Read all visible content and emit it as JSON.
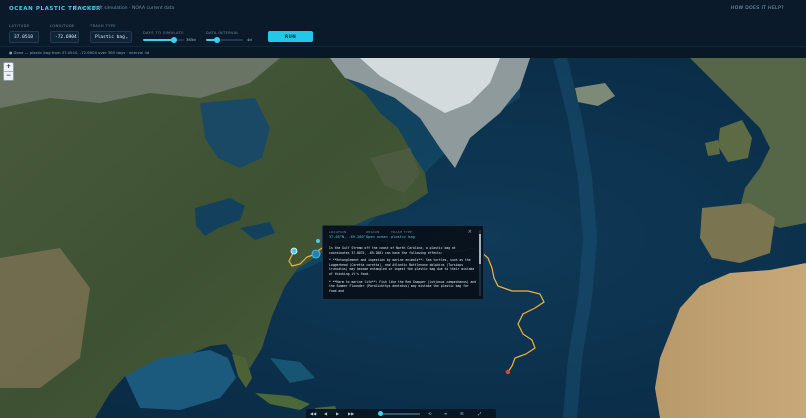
{
  "header": {
    "title": "OCEAN PLASTIC TRACKER",
    "subtitle": "Oceanic drift simulation · NOAA current data",
    "help_link": "HOW DOES IT HELP?"
  },
  "controls": {
    "latitude": {
      "label": "LATITUDE",
      "value": "37.0510"
    },
    "longitude": {
      "label": "LONGITUDE",
      "value": "-72.6904"
    },
    "trash_type": {
      "label": "TRASH TYPE",
      "value": "Plastic bag"
    },
    "days_to_simulate": {
      "label": "DAYS TO SIMULATE",
      "value_text": "365d",
      "fraction": 0.75
    },
    "data_interval": {
      "label": "DATA INTERVAL",
      "value_text": "4d",
      "fraction": 0.3
    },
    "run_button": "RUN SIMULATION"
  },
  "status": {
    "text": "● Done — plastic bag from 37.0510, -72.6904 over 365 days · interval 4d"
  },
  "map": {
    "zoom_in": "+",
    "zoom_out": "−"
  },
  "popup": {
    "location_label": "LOCATION",
    "location_value": "37.05°N, -69.280°",
    "region_label": "REGION",
    "region_value": "Open ocean",
    "type_label": "TRASH TYPE",
    "type_value": "plastic bag",
    "close": "×",
    "paragraphs": [
      "In the Gulf Stream off the coast of North Carolina, a plastic bag at coordinates 37.0075, -69.2801 can have the following effects:",
      "* **Entanglement and ingestion by marine animals**: Sea turtles, such as the Loggerhead (Caretta caretta), and Atlantic Bottlenose dolphins (Tursiops truncatus) may become entangled or ingest the plastic bag due to their mistake of thinking it's food.",
      "* **Harm to marine life**: Fish like the Red Snapper (Lutjanus campechanus) and the Summer Flounder (Paralichthys dentatus) may mistake the plastic bag for food and"
    ]
  },
  "timeline": {
    "buttons": [
      "◀◀",
      "◀",
      "▶",
      "▶▶"
    ],
    "extras": [
      "⟲",
      "≡",
      "☰",
      "⤢"
    ]
  },
  "colors": {
    "accent": "#3fd0f0",
    "track": "#f0b43a",
    "end_marker": "#e0453a"
  }
}
